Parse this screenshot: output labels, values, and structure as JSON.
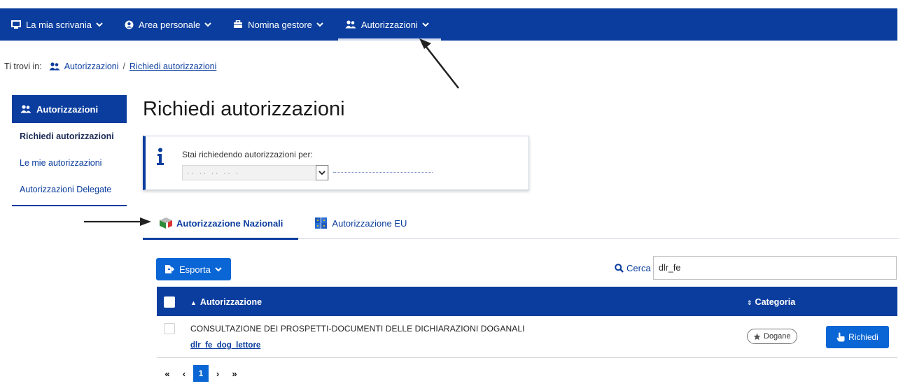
{
  "topnav": {
    "items": [
      {
        "label": "La mia scrivania",
        "icon": "desktop-icon"
      },
      {
        "label": "Area personale",
        "icon": "user-circle-icon"
      },
      {
        "label": "Nomina gestore",
        "icon": "briefcase-icon"
      },
      {
        "label": "Autorizzazioni",
        "icon": "users-icon"
      }
    ]
  },
  "breadcrumb": {
    "prefix": "Ti trovi in:",
    "parent": "Autorizzazioni",
    "separator": "/",
    "current": "Richiedi autorizzazioni"
  },
  "sidebar": {
    "header": "Autorizzazioni",
    "items": [
      {
        "label": "Richiedi autorizzazioni"
      },
      {
        "label": "Le mie autorizzazioni"
      },
      {
        "label": "Autorizzazioni Delegate"
      }
    ]
  },
  "page": {
    "title": "Richiedi autorizzazioni"
  },
  "info": {
    "text": "Stai richiedendo autorizzazioni per:",
    "select_value": "·· ·· ·· ·· ·"
  },
  "tabs": [
    {
      "label": "Autorizzazione Nazionali"
    },
    {
      "label": "Autorizzazione EU"
    }
  ],
  "toolbar": {
    "export_label": "Esporta",
    "search_label": "Cerca",
    "search_value": "dlr_fe"
  },
  "table": {
    "columns": [
      "Autorizzazione",
      "Categoria"
    ],
    "rows": [
      {
        "title": "CONSULTAZIONE DEI PROSPETTI-DOCUMENTI DELLE DICHIARAZIONI DOGANALI",
        "code": "dlr_fe_dog_lettore",
        "category": "Dogane",
        "action": "Richiedi"
      }
    ]
  },
  "pagination": {
    "first": "«",
    "prev": "‹",
    "current": "1",
    "next": "›",
    "last": "»"
  },
  "colors": {
    "navbar": "#0a3d9e",
    "button": "#0a66d4"
  }
}
